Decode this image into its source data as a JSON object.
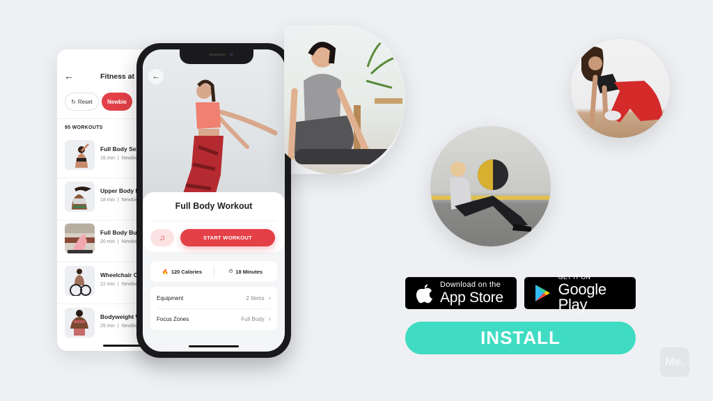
{
  "list_screen": {
    "back_icon": "arrow-left-icon",
    "title": "Fitness at Home",
    "chips": [
      {
        "label": "Reset",
        "icon": "refresh-icon",
        "active": false
      },
      {
        "label": "Newbie",
        "active": true
      }
    ],
    "workouts_count": "95 WORKOUTS",
    "workouts": [
      {
        "name": "Full Body Set",
        "duration": "16 min",
        "level": "Newbie"
      },
      {
        "name": "Upper Body Burn",
        "duration": "18 min",
        "level": "Newbie"
      },
      {
        "name": "Full Body Burn",
        "duration": "20 min",
        "level": "Newbie"
      },
      {
        "name": "Wheelchair Cardio",
        "duration": "22 min",
        "level": "Newbie"
      },
      {
        "name": "Bodyweight Workout",
        "duration": "25 min",
        "level": "Newbie"
      }
    ]
  },
  "detail_screen": {
    "back_icon": "arrow-left-icon",
    "title": "Full Body Workout",
    "music_icon": "music-note-icon",
    "start_button": "START WORKOUT",
    "stats": [
      {
        "icon": "flame-icon",
        "value": "120 Calories"
      },
      {
        "icon": "stopwatch-icon",
        "value": "18 Minutes"
      }
    ],
    "info_rows": [
      {
        "label": "Equipment",
        "value": "2 Items"
      },
      {
        "label": "Focus Zones",
        "value": "Full Body"
      }
    ]
  },
  "store_badges": {
    "apple": {
      "small": "Download on the",
      "big": "App Store"
    },
    "google": {
      "small": "GET IT ON",
      "big": "Google Play"
    }
  },
  "install_button": "INSTALL",
  "logo": "Me.",
  "colors": {
    "accent_red": "#e34048",
    "install_teal": "#3fdcc3",
    "background": "#eef0f3"
  }
}
